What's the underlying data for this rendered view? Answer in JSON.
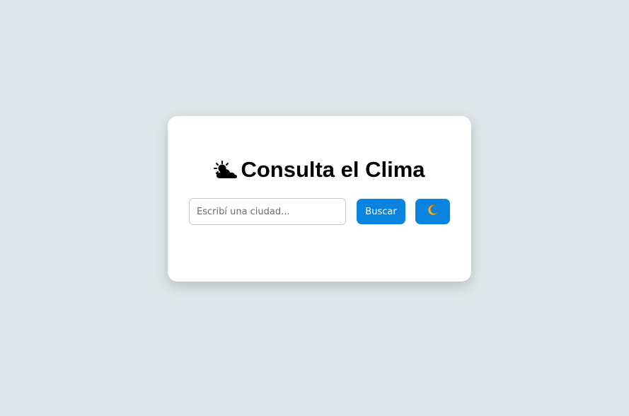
{
  "card": {
    "title": "Consulta el Clima",
    "title_icon": "sun-behind-cloud-icon"
  },
  "search": {
    "placeholder": "Escribí una ciudad...",
    "value": "",
    "button_label": "Buscar"
  },
  "theme_toggle": {
    "icon": "crescent-moon-icon"
  },
  "colors": {
    "background": "#dfe6e9",
    "card": "#ffffff",
    "accent": "#0a84e0",
    "title": "#000000"
  }
}
